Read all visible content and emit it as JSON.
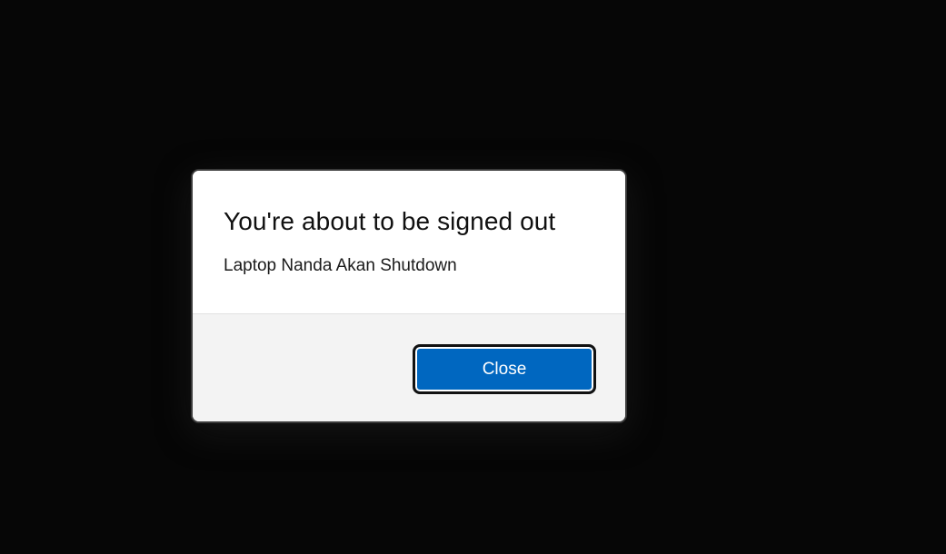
{
  "dialog": {
    "title": "You're about to be signed out",
    "message": "Laptop Nanda Akan Shutdown",
    "close_label": "Close"
  },
  "colors": {
    "background": "#060606",
    "dialog_body": "#ffffff",
    "dialog_footer": "#f3f3f3",
    "accent": "#0067c0"
  }
}
